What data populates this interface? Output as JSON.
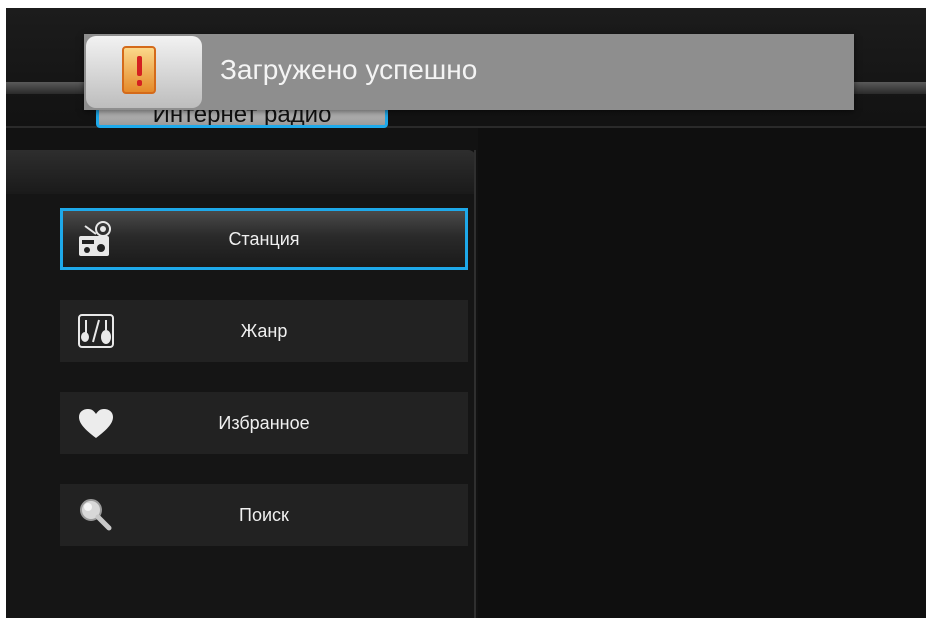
{
  "header": {
    "tab_label": "Интернет радио"
  },
  "notification": {
    "icon": "warning-exclamation-icon",
    "message": "Загружено успешно"
  },
  "menu": {
    "items": [
      {
        "label": "Станция",
        "icon": "radio-station-icon",
        "selected": true
      },
      {
        "label": "Жанр",
        "icon": "genre-instruments-icon",
        "selected": false
      },
      {
        "label": "Избранное",
        "icon": "heart-icon",
        "selected": false
      },
      {
        "label": "Поиск",
        "icon": "search-magnifier-icon",
        "selected": false
      }
    ]
  },
  "colors": {
    "accent": "#1ea9ea",
    "background": "#121212",
    "banner": "#8e8e8e"
  }
}
